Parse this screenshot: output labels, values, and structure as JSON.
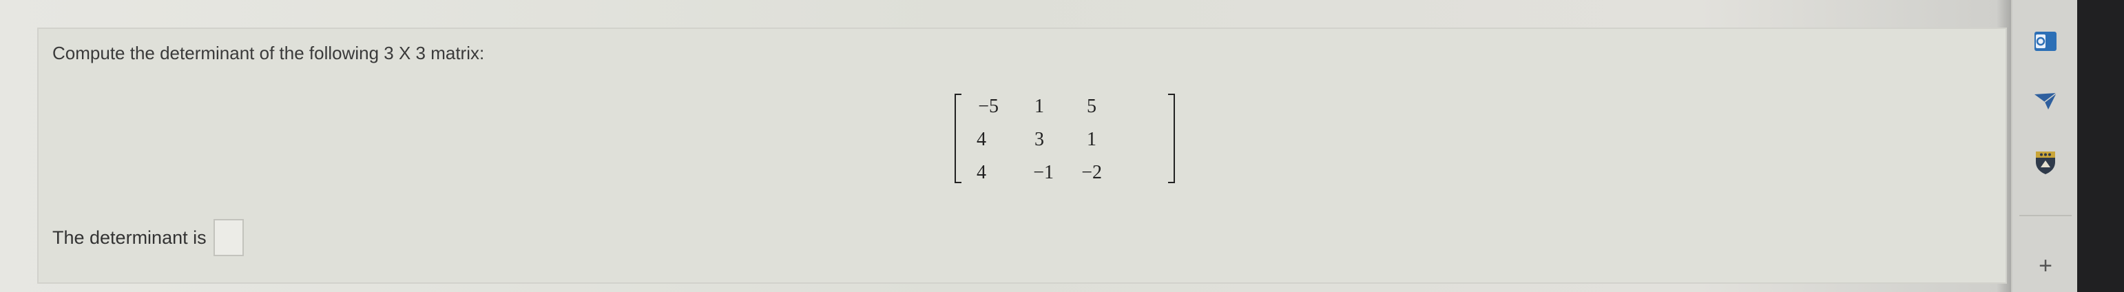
{
  "question": {
    "prompt": "Compute the determinant of the following 3 X 3 matrix:",
    "matrix": [
      [
        "−5",
        "1",
        "5"
      ],
      [
        "4",
        "3",
        "1"
      ],
      [
        "4",
        "−1",
        "−2"
      ]
    ],
    "answer_label": "The determinant is",
    "answer_value": ""
  },
  "side_toolbar": {
    "icons": [
      "office-icon",
      "send-icon",
      "shield-crest-icon",
      "add-icon"
    ],
    "add_label": "+"
  },
  "colors": {
    "background": "#e4e3de",
    "card": "#dfe0d9",
    "text": "#3a3a3a",
    "office_blue": "#2c6fb6",
    "send_blue": "#2e5f9e",
    "crest_gold": "#c9a53a"
  }
}
